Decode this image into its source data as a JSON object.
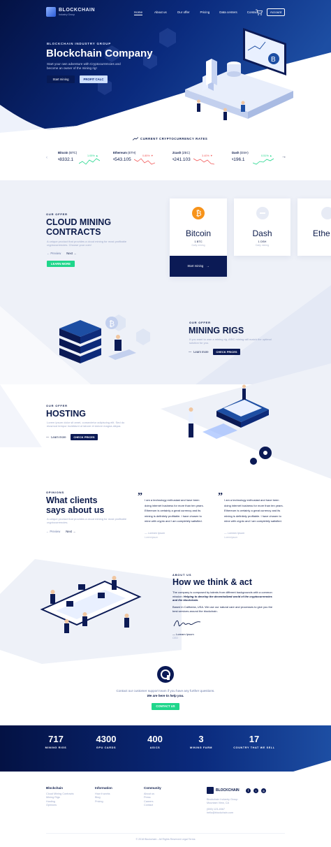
{
  "nav": {
    "logo_text": "BLOCKCHAIN",
    "logo_sub": "Industry Group",
    "items": [
      "Home",
      "About us",
      "Our offer",
      "Pricing",
      "Data centers",
      "Contact"
    ],
    "account": "Account"
  },
  "hero": {
    "eyebrow": "BLOCKCHAIN INDUSTRY GROUP",
    "title": "Blockchain Company",
    "desc": "Start your own adventure with Cryptocurrencies and become an owner of the mining rig!",
    "btn_start": "Start mining",
    "btn_calc": "PROFIT CALC"
  },
  "rates": {
    "title": "CURRENT CRYPTOCURRENCY RATES",
    "items": [
      {
        "name": "Bitcoin",
        "code": "(BTC)",
        "price": "8332.1",
        "change": "1.05% ▲",
        "up": true
      },
      {
        "name": "Ethereum",
        "code": "(ETH)",
        "price": "543.105",
        "change": "0.85% ▼",
        "up": false
      },
      {
        "name": "Zcash",
        "code": "(ZEC)",
        "price": "241.103",
        "change": "3.40% ▼",
        "up": false
      },
      {
        "name": "Dash",
        "code": "(DSH)",
        "price": "196.1",
        "change": "0.51% ▲",
        "up": true
      }
    ],
    "currency": "$"
  },
  "offer": {
    "eyebrow": "OUR OFFER",
    "title_1": "CLOUD MINING",
    "title_2": "CONTRACTS",
    "desc": "A unique product that provides a cloud mining for most profitable cryptocurrencies. Choose your coin!",
    "prev": "Preview",
    "next": "Next",
    "btn": "LEARN MORE",
    "cards": [
      {
        "name": "Bitcoin",
        "sub": "1 BTC",
        "sub2": "Daily mining",
        "btn": "Start mining"
      },
      {
        "name": "Dash",
        "sub": "1 DSH",
        "sub2": "Daily mining"
      },
      {
        "name": "Ethe"
      }
    ]
  },
  "rigs": {
    "eyebrow": "OUR OFFER",
    "title": "MINING RIGS",
    "desc": "If you want to own a mining rig, ASIC mining will match the optimal solution for you.",
    "learn": "Learn more",
    "btn": "CHECK PRICES"
  },
  "hosting": {
    "eyebrow": "OUR OFFER",
    "title": "HOSTING",
    "desc": "Lorem ipsum dolor sit amet, consectetur adipiscing elit. Sed do eiusmod tempor incididunt ut labore et dolore magna aliqua.",
    "learn": "Learn more",
    "btn": "CHECK PRICES"
  },
  "opinions": {
    "eyebrow": "OPINIONS",
    "title_1": "What clients",
    "title_2": "says about us",
    "desc": "A unique product that provides a cloud mining for most profitable cryptocurrencies.",
    "prev": "Preview",
    "next": "Next",
    "quotes": [
      {
        "text": "I am a technology enthusiast and have been doing internet business for more than ten years. Ethereum is certainly a great currency and its mining is definitely profitable. I have chosen to mine with crypto and I am completely satisfied.",
        "author": "— Loream Ipsum",
        "role": "Loremipsum"
      },
      {
        "text": "I am a technology enthusiast and have been doing internet business for more than ten years. Ethereum is certainly a great currency and its mining is definitely profitable. I have chosen to mine with crypto and I am completely satisfied.",
        "author": "— Loream Ipsum",
        "role": "Loremipsum"
      }
    ]
  },
  "about": {
    "eyebrow": "ABOUT US",
    "title": "How we think & act",
    "p1": "The company is composed by talents from different backgrounds with a common mission:",
    "p1_em": "Helping to develop the decentralized world of the cryptocurrencies and the blockchain.",
    "p2": "Based in California, USA. We use our natural care and processes to give you the best services around the blockchain.",
    "sign_name": "— Loream Ipsum",
    "sign_role": "CEO"
  },
  "contact": {
    "text": "Contact our customer support team if you have any further questions.",
    "text_em": "We are here to help you.",
    "btn": "CONTACT US"
  },
  "stats": [
    {
      "num": "717",
      "label": "MINING RIGS"
    },
    {
      "num": "4300",
      "label": "GPU CARDS"
    },
    {
      "num": "400",
      "label": "ASICS"
    },
    {
      "num": "3",
      "label": "MINING FARM"
    },
    {
      "num": "17",
      "label": "COUNTRY THAT WE SELL"
    }
  ],
  "footer": {
    "cols": [
      {
        "head": "Blockchain",
        "links": [
          "Cloud Mining Contracts",
          "Mining Rigs",
          "Hosting",
          "Opinions"
        ]
      },
      {
        "head": "Information",
        "links": [
          "How it works",
          "Blog",
          "Pricing"
        ]
      },
      {
        "head": "Community",
        "links": [
          "About us",
          "Press",
          "Careers",
          "Contact"
        ]
      }
    ],
    "brand_lines": [
      "Blockchain Industry Group",
      "Mountain View, CA",
      "(555) 123-4567",
      "hello@blockchain.com"
    ],
    "copyright": "© 2018 Blockchain - All Rights Reserved Legal Terms"
  },
  "colors": {
    "navy": "#0b1a55",
    "green": "#1fd68b",
    "blue": "#1d4ea3"
  }
}
